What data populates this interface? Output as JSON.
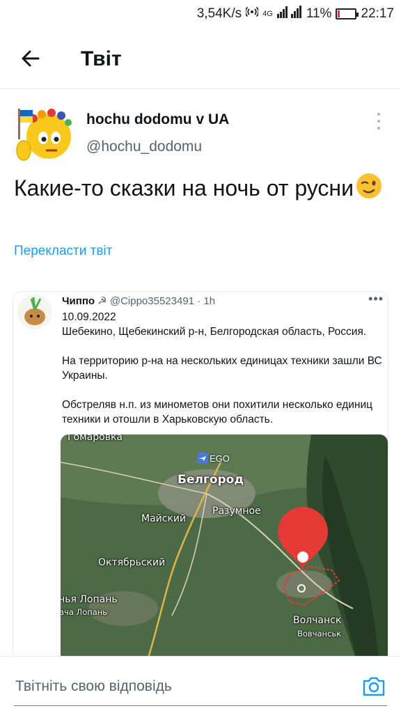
{
  "status_bar": {
    "speed": "3,54K/s",
    "network": "4G",
    "battery": "11%",
    "battery_level": 0.11,
    "time": "22:17"
  },
  "header": {
    "title": "Твіт"
  },
  "tweet": {
    "author_name": "hochu dodomu v UA",
    "author_handle": "@hochu_dodomu",
    "text": "Какие-то сказки на ночь от русни",
    "translate_label": "Перекласти твіт"
  },
  "embedded_tweet": {
    "name": "Чиппо",
    "name_symbol": "☭",
    "handle": "@Cippo35523491",
    "separator": "·",
    "age": "1h",
    "more": "•••",
    "date": "10.09.2022",
    "location": "Шебекино, Щебекинский р-н, Белгородская область, Россия.",
    "paragraph1": "На территорию р-на на нескольких единицах техники зашли ВС Украины.",
    "paragraph2": "Обстреляв н.п. из минометов они похитили несколько единиц техники и отошли в Харьковскую область.",
    "map": {
      "labels": {
        "gomarovka": "Гомаровка",
        "airport": "EGO",
        "belgorod": "Белгород",
        "maysky": "Майский",
        "razumnoe": "Разумное",
        "oktyabrsky": "Октябрьский",
        "lopan1": "чья Лопань",
        "lopan2": "ача Лопань",
        "volchansk": "Волчанск",
        "vovchansk": "Вовчанськ"
      }
    }
  },
  "reply": {
    "placeholder": "Твітніть свою відповідь"
  },
  "colors": {
    "accent": "#1d9bf0",
    "text_primary": "#0f1419",
    "text_secondary": "#536471",
    "map_pin": "#e53935"
  }
}
